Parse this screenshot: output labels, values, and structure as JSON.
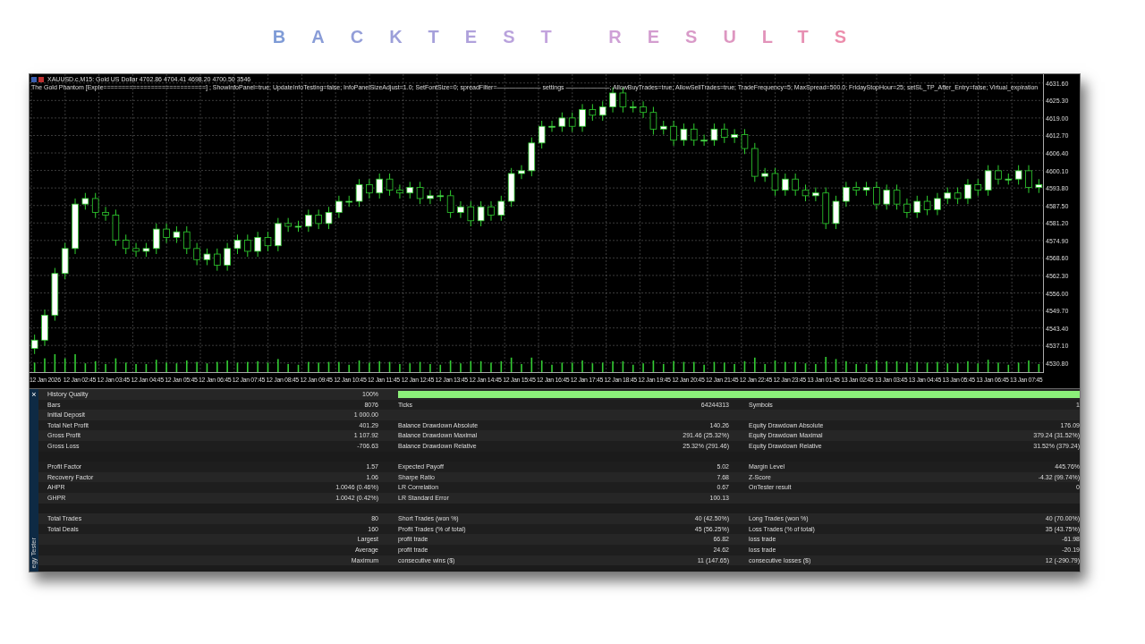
{
  "page_title": "BACKTEST RESULTS",
  "chart": {
    "symbol_line": "XAUUSD.c,M15:  Gold US Dollar  4702.86  4704.41  4698.20  4700.50  3546",
    "expert_line": "The Gold Phantom [ExpIe============================] ; ShowInfoPanel=true; UpdateInfoTesting=false; InfoPanelSizeAdjust=1.0; SetFontSize=0; spreadFilter=——————— settings ———————; AllowBuyTrades=true; AllowSellTrades=true; TradeFrequency=5; MaxSpread=500.0; FridayStopHour=25; setSL_TP_After_Entry=false; Virtual_expiration",
    "time_labels": [
      "12 Jan 2026",
      "12 Jan 02:45",
      "12 Jan 03:45",
      "12 Jan 04:45",
      "12 Jan 05:45",
      "12 Jan 06:45",
      "12 Jan 07:45",
      "12 Jan 08:45",
      "12 Jan 09:45",
      "12 Jan 10:45",
      "12 Jan 11:45",
      "12 Jan 12:45",
      "12 Jan 13:45",
      "12 Jan 14:45",
      "12 Jan 15:45",
      "12 Jan 16:45",
      "12 Jan 17:45",
      "12 Jan 18:45",
      "12 Jan 19:45",
      "12 Jan 20:45",
      "12 Jan 21:45",
      "12 Jan 22:45",
      "12 Jan 23:45",
      "13 Jan 01:45",
      "13 Jan 02:45",
      "13 Jan 03:45",
      "13 Jan 04:45",
      "13 Jan 05:45",
      "13 Jan 06:45",
      "13 Jan 07:45"
    ],
    "chart_data": {
      "type": "candlestick",
      "grid": true,
      "ylim": [
        4527.5,
        4634.75
      ],
      "yticks": [
        {
          "value": 4631.6,
          "label": "4631.60"
        },
        {
          "value": 4625.3,
          "label": "4625.30"
        },
        {
          "value": 4619.0,
          "label": "4619.00"
        },
        {
          "value": 4612.7,
          "label": "4612.70"
        },
        {
          "value": 4606.4,
          "label": "4606.40"
        },
        {
          "value": 4600.1,
          "label": "4600.10"
        },
        {
          "value": 4593.8,
          "label": "4593.80"
        },
        {
          "value": 4587.5,
          "label": "4587.50"
        },
        {
          "value": 4581.2,
          "label": "4581.20"
        },
        {
          "value": 4574.9,
          "label": "4574.90"
        },
        {
          "value": 4568.6,
          "label": "4568.60"
        },
        {
          "value": 4562.3,
          "label": "4562.30"
        },
        {
          "value": 4556.0,
          "label": "4556.00"
        },
        {
          "value": 4549.7,
          "label": "4549.70"
        },
        {
          "value": 4543.4,
          "label": "4543.40"
        },
        {
          "value": 4537.1,
          "label": "4537.10"
        },
        {
          "value": 4530.8,
          "label": "4530.80"
        }
      ],
      "ohlc": [
        [
          4536,
          4541,
          4534,
          4539
        ],
        [
          4539,
          4550,
          4537,
          4548
        ],
        [
          4548,
          4565,
          4546,
          4563
        ],
        [
          4563,
          4574,
          4561,
          4572
        ],
        [
          4572,
          4590,
          4570,
          4588
        ],
        [
          4588,
          4592,
          4586,
          4590
        ],
        [
          4590,
          4592,
          4583,
          4585
        ],
        [
          4585,
          4587,
          4582,
          4584
        ],
        [
          4584,
          4586,
          4573,
          4575
        ],
        [
          4575,
          4577,
          4570,
          4572
        ],
        [
          4572,
          4574,
          4569,
          4571
        ],
        [
          4571,
          4574,
          4569,
          4572
        ],
        [
          4572,
          4581,
          4570,
          4579
        ],
        [
          4579,
          4581,
          4574,
          4576
        ],
        [
          4576,
          4580,
          4574,
          4578
        ],
        [
          4578,
          4580,
          4570,
          4572
        ],
        [
          4572,
          4574,
          4566,
          4568
        ],
        [
          4568,
          4572,
          4566,
          4570
        ],
        [
          4570,
          4572,
          4564,
          4566
        ],
        [
          4566,
          4574,
          4564,
          4572
        ],
        [
          4572,
          4577,
          4570,
          4575
        ],
        [
          4575,
          4577,
          4569,
          4571
        ],
        [
          4571,
          4578,
          4569,
          4576
        ],
        [
          4576,
          4578,
          4571,
          4573
        ],
        [
          4573,
          4583,
          4571,
          4581
        ],
        [
          4581,
          4583,
          4578,
          4580
        ],
        [
          4580,
          4582,
          4578,
          4580
        ],
        [
          4580,
          4586,
          4578,
          4584
        ],
        [
          4584,
          4586,
          4579,
          4581
        ],
        [
          4581,
          4587,
          4579,
          4585
        ],
        [
          4585,
          4591,
          4583,
          4589
        ],
        [
          4589,
          4591,
          4587,
          4589
        ],
        [
          4589,
          4597,
          4587,
          4595
        ],
        [
          4595,
          4597,
          4590,
          4592
        ],
        [
          4592,
          4599,
          4590,
          4597
        ],
        [
          4597,
          4599,
          4591,
          4593
        ],
        [
          4593,
          4595,
          4590,
          4592
        ],
        [
          4592,
          4596,
          4590,
          4594
        ],
        [
          4594,
          4596,
          4588,
          4590
        ],
        [
          4590,
          4593,
          4588,
          4591
        ],
        [
          4591,
          4593,
          4589,
          4591
        ],
        [
          4591,
          4593,
          4583,
          4585
        ],
        [
          4585,
          4589,
          4583,
          4587
        ],
        [
          4587,
          4589,
          4580,
          4582
        ],
        [
          4582,
          4589,
          4580,
          4587
        ],
        [
          4587,
          4589,
          4582,
          4584
        ],
        [
          4584,
          4591,
          4582,
          4589
        ],
        [
          4589,
          4601,
          4587,
          4599
        ],
        [
          4599,
          4602,
          4597,
          4600
        ],
        [
          4600,
          4612,
          4598,
          4610
        ],
        [
          4610,
          4618,
          4608,
          4616
        ],
        [
          4616,
          4618,
          4614,
          4616
        ],
        [
          4616,
          4621,
          4614,
          4619
        ],
        [
          4619,
          4621,
          4614,
          4616
        ],
        [
          4616,
          4624,
          4614,
          4622
        ],
        [
          4622,
          4624,
          4618,
          4620
        ],
        [
          4620,
          4625,
          4618,
          4623
        ],
        [
          4623,
          4630,
          4621,
          4628
        ],
        [
          4628,
          4630,
          4621,
          4623
        ],
        [
          4623,
          4625,
          4621,
          4623
        ],
        [
          4623,
          4625,
          4619,
          4621
        ],
        [
          4621,
          4623,
          4613,
          4615
        ],
        [
          4615,
          4618,
          4613,
          4616
        ],
        [
          4616,
          4618,
          4609,
          4611
        ],
        [
          4611,
          4617,
          4609,
          4615
        ],
        [
          4615,
          4617,
          4609,
          4611
        ],
        [
          4611,
          4613,
          4609,
          4611
        ],
        [
          4611,
          4617,
          4609,
          4615
        ],
        [
          4615,
          4617,
          4610,
          4612
        ],
        [
          4612,
          4615,
          4610,
          4613
        ],
        [
          4613,
          4615,
          4606,
          4608
        ],
        [
          4608,
          4610,
          4596,
          4598
        ],
        [
          4598,
          4601,
          4596,
          4599
        ],
        [
          4599,
          4601,
          4591,
          4593
        ],
        [
          4593,
          4599,
          4591,
          4597
        ],
        [
          4597,
          4599,
          4591,
          4593
        ],
        [
          4593,
          4595,
          4589,
          4591
        ],
        [
          4591,
          4594,
          4589,
          4592
        ],
        [
          4592,
          4594,
          4579,
          4581
        ],
        [
          4581,
          4591,
          4579,
          4589
        ],
        [
          4589,
          4596,
          4587,
          4594
        ],
        [
          4594,
          4596,
          4591,
          4593
        ],
        [
          4593,
          4596,
          4591,
          4594
        ],
        [
          4594,
          4596,
          4586,
          4588
        ],
        [
          4588,
          4595,
          4586,
          4593
        ],
        [
          4593,
          4595,
          4586,
          4588
        ],
        [
          4588,
          4590,
          4583,
          4585
        ],
        [
          4585,
          4591,
          4583,
          4589
        ],
        [
          4589,
          4591,
          4584,
          4586
        ],
        [
          4586,
          4592,
          4584,
          4590
        ],
        [
          4590,
          4594,
          4588,
          4592
        ],
        [
          4592,
          4594,
          4588,
          4590
        ],
        [
          4590,
          4597,
          4588,
          4595
        ],
        [
          4595,
          4597,
          4591,
          4593
        ],
        [
          4593,
          4602,
          4591,
          4600
        ],
        [
          4600,
          4602,
          4595,
          4597
        ],
        [
          4597,
          4599,
          4595,
          4597
        ],
        [
          4597,
          4602,
          4595,
          4600
        ],
        [
          4600,
          4602,
          4592,
          4594
        ],
        [
          4594,
          4597,
          4592,
          4595
        ]
      ]
    }
  },
  "report": {
    "close": "×",
    "side_tab": "egy Tester",
    "rows": [
      {
        "kind": "quality",
        "label_1": "History Quality",
        "value_1": "100%",
        "level": 1
      },
      {
        "kind": "stats",
        "label_1": "Bars",
        "value_1": "8076",
        "label_2": "Ticks",
        "value_2": "64244313",
        "label_3": "Symbols",
        "value_3": "1"
      },
      {
        "kind": "stats",
        "label_1": "Initial Deposit",
        "value_1": "1 000.00"
      },
      {
        "kind": "stats",
        "label_1": "Total Net Profit",
        "value_1": "401.29",
        "label_2": "Balance Drawdown Absolute",
        "value_2": "140.26",
        "label_3": "Equity Drawdown Absolute",
        "value_3": "176.09"
      },
      {
        "kind": "stats",
        "label_1": "Gross Profit",
        "value_1": "1 107.92",
        "label_2": "Balance Drawdown Maximal",
        "value_2": "291.46 (25.32%)",
        "label_3": "Equity Drawdown Maximal",
        "value_3": "379.24 (31.52%)"
      },
      {
        "kind": "stats",
        "label_1": "Gross Loss",
        "value_1": "-706.63",
        "label_2": "Balance Drawdown Relative",
        "value_2": "25.32% (291.46)",
        "label_3": "Equity Drawdown Relative",
        "value_3": "31.52% (379.24)"
      },
      {
        "kind": "spacer"
      },
      {
        "kind": "stats",
        "label_1": "Profit Factor",
        "value_1": "1.57",
        "label_2": "Expected Payoff",
        "value_2": "5.02",
        "label_3": "Margin Level",
        "value_3": "445.76%"
      },
      {
        "kind": "stats",
        "label_1": "Recovery Factor",
        "value_1": "1.06",
        "label_2": "Sharpe Ratio",
        "value_2": "7.68",
        "label_3": "Z-Score",
        "value_3": "-4.32 (99.74%)"
      },
      {
        "kind": "stats",
        "label_1": "AHPR",
        "value_1": "1.0046 (0.46%)",
        "label_2": "LR Correlation",
        "value_2": "0.67",
        "label_3": "OnTester result",
        "value_3": "0"
      },
      {
        "kind": "stats",
        "label_1": "GHPR",
        "value_1": "1.0042 (0.42%)",
        "label_2": "LR Standard Error",
        "value_2": "100.13"
      },
      {
        "kind": "spacer"
      },
      {
        "kind": "stats",
        "label_1": "Total Trades",
        "value_1": "80",
        "label_2": "Short Trades (won %)",
        "value_2": "40 (42.50%)",
        "label_3": "Long Trades (won %)",
        "value_3": "40 (70.00%)"
      },
      {
        "kind": "stats",
        "label_1": "Total Deals",
        "value_1": "160",
        "label_2": "Profit Trades (% of total)",
        "value_2": "45 (56.25%)",
        "label_3": "Loss Trades (% of total)",
        "value_3": "35 (43.75%)"
      },
      {
        "kind": "stats",
        "value_1": "Largest",
        "label_2": "profit trade",
        "value_2": "66.82",
        "label_3": "loss trade",
        "value_3": "-61.98"
      },
      {
        "kind": "stats",
        "value_1": "Average",
        "label_2": "profit trade",
        "value_2": "24.62",
        "label_3": "loss trade",
        "value_3": "-20.19"
      },
      {
        "kind": "stats",
        "value_1": "Maximum",
        "label_2": "consecutive wins ($)",
        "value_2": "11 (147.65)",
        "label_3": "consecutive losses ($)",
        "value_3": "12 (-290.79)"
      }
    ]
  }
}
